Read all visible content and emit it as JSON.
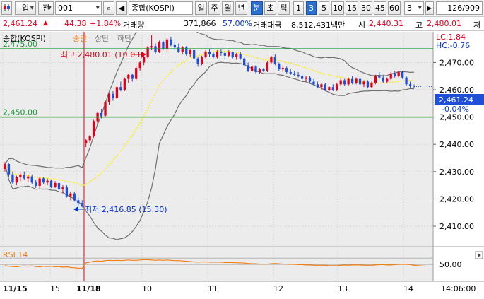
{
  "toolbar": {
    "code": "001",
    "name": "종합(KOSPI)",
    "up_label": "업",
    "all_label": "전",
    "periods": [
      "일",
      "주",
      "월",
      "년",
      "분",
      "초",
      "틱"
    ],
    "selected_period": "분",
    "intervals": [
      "1",
      "3",
      "5",
      "10",
      "15",
      "30",
      "45",
      "60"
    ],
    "selected_interval": "3",
    "interval_value": "3",
    "count": "126/909"
  },
  "quote": {
    "price": "2,461.24",
    "change": "44.38",
    "change_pct": "+1.84%",
    "volume_label": "거래량",
    "volume": "371,866",
    "volume_ratio": "57.00%",
    "amount_label": "거래대금",
    "amount": "8,512,431백만",
    "open_label": "시",
    "open": "2,440.31",
    "high_label": "고",
    "high": "2,480.01",
    "low_label": "저"
  },
  "colors": {
    "up": "#e0001a",
    "down": "#1f4ed8",
    "band": "#707070",
    "mid": "#ffee00",
    "hline": "#1a9a3a",
    "rsi": "#f07f17",
    "marker": "#e0001a"
  },
  "chart_data": [
    {
      "type": "candlestick",
      "title": "종합(KOSPI)",
      "legend": [
        "중단",
        "상단",
        "하단"
      ],
      "lc_label": "LC:1.84",
      "hc_label": "HC:-0.76",
      "ylim": [
        2403,
        2481
      ],
      "y_ticks": [
        "2,470.00",
        "2,460.00",
        "2,450.00",
        "2,440.00",
        "2,430.00",
        "2,420.00",
        "2,410.00"
      ],
      "x_labels": [
        "11/15",
        "15",
        "11/18",
        "10",
        "11",
        "12",
        "13",
        "14"
      ],
      "hlines": [
        "2,475.00",
        "2,450.00"
      ],
      "high_annotation": "최고 2,480.01 (10:03)",
      "low_annotation": "최저 2,416.85 (15:30)",
      "last_price": "2,461.24",
      "last_change": "-0.04%",
      "time": "14:06:00",
      "candles": [
        [
          2431.0,
          2433.5,
          2430.0,
          2432.8
        ],
        [
          2432.8,
          2433.0,
          2428.0,
          2429.0
        ],
        [
          2429.0,
          2430.0,
          2425.5,
          2426.0
        ],
        [
          2426.0,
          2428.5,
          2425.0,
          2427.9
        ],
        [
          2427.9,
          2429.5,
          2426.5,
          2428.8
        ],
        [
          2428.8,
          2430.0,
          2427.0,
          2427.5
        ],
        [
          2427.5,
          2429.0,
          2426.0,
          2428.2
        ],
        [
          2428.2,
          2429.0,
          2425.5,
          2426.0
        ],
        [
          2426.0,
          2427.0,
          2424.0,
          2424.8
        ],
        [
          2424.8,
          2428.0,
          2424.0,
          2427.5
        ],
        [
          2427.5,
          2428.0,
          2425.5,
          2426.0
        ],
        [
          2426.0,
          2427.5,
          2425.0,
          2426.7
        ],
        [
          2426.7,
          2427.0,
          2424.0,
          2424.5
        ],
        [
          2424.5,
          2426.5,
          2424.0,
          2425.8
        ],
        [
          2425.8,
          2426.0,
          2423.0,
          2423.5
        ],
        [
          2423.5,
          2425.0,
          2422.0,
          2424.2
        ],
        [
          2424.2,
          2425.0,
          2420.5,
          2421.0
        ],
        [
          2421.0,
          2422.5,
          2419.5,
          2422.0
        ],
        [
          2422.0,
          2422.5,
          2419.0,
          2419.5
        ],
        [
          2419.5,
          2420.5,
          2417.5,
          2418.5
        ],
        [
          2418.5,
          2419.5,
          2416.9,
          2417.2
        ],
        [
          2440.3,
          2442.0,
          2439.0,
          2441.5
        ],
        [
          2441.5,
          2443.5,
          2440.5,
          2443.0
        ],
        [
          2443.0,
          2449.0,
          2442.5,
          2448.5
        ],
        [
          2448.5,
          2452.0,
          2447.5,
          2451.5
        ],
        [
          2451.5,
          2453.0,
          2449.5,
          2450.5
        ],
        [
          2450.5,
          2456.0,
          2450.0,
          2455.5
        ],
        [
          2455.5,
          2459.0,
          2454.5,
          2458.5
        ],
        [
          2458.5,
          2459.5,
          2456.0,
          2457.0
        ],
        [
          2457.0,
          2461.5,
          2456.5,
          2461.0
        ],
        [
          2461.0,
          2463.0,
          2459.5,
          2460.0
        ],
        [
          2460.0,
          2464.5,
          2459.5,
          2464.0
        ],
        [
          2464.0,
          2466.0,
          2462.5,
          2465.5
        ],
        [
          2465.5,
          2466.0,
          2463.0,
          2464.0
        ],
        [
          2464.0,
          2468.5,
          2463.5,
          2468.0
        ],
        [
          2468.0,
          2470.5,
          2467.0,
          2470.0
        ],
        [
          2470.0,
          2472.5,
          2469.0,
          2472.0
        ],
        [
          2472.0,
          2476.0,
          2471.5,
          2475.5
        ],
        [
          2475.5,
          2480.0,
          2474.5,
          2476.0
        ],
        [
          2476.0,
          2477.0,
          2473.0,
          2474.0
        ],
        [
          2474.0,
          2478.0,
          2473.5,
          2477.5
        ],
        [
          2477.5,
          2478.0,
          2474.5,
          2475.0
        ],
        [
          2475.0,
          2479.0,
          2474.0,
          2478.5
        ],
        [
          2478.5,
          2479.5,
          2476.0,
          2476.5
        ],
        [
          2476.5,
          2477.5,
          2474.5,
          2475.5
        ],
        [
          2475.5,
          2477.0,
          2473.5,
          2474.0
        ],
        [
          2474.0,
          2476.0,
          2473.0,
          2475.5
        ],
        [
          2475.5,
          2476.0,
          2472.5,
          2473.0
        ],
        [
          2473.0,
          2475.0,
          2472.0,
          2474.5
        ],
        [
          2474.5,
          2475.0,
          2471.0,
          2471.5
        ],
        [
          2471.5,
          2472.0,
          2468.5,
          2469.5
        ],
        [
          2469.5,
          2472.5,
          2469.0,
          2472.0
        ],
        [
          2472.0,
          2474.5,
          2471.5,
          2474.0
        ],
        [
          2474.0,
          2475.0,
          2472.0,
          2473.0
        ],
        [
          2473.0,
          2474.0,
          2471.5,
          2472.0
        ],
        [
          2472.0,
          2474.5,
          2471.5,
          2474.0
        ],
        [
          2474.0,
          2475.0,
          2472.5,
          2473.5
        ],
        [
          2473.5,
          2474.0,
          2471.0,
          2472.5
        ],
        [
          2472.5,
          2474.5,
          2472.0,
          2473.8
        ],
        [
          2473.8,
          2474.0,
          2471.5,
          2472.0
        ],
        [
          2472.0,
          2473.5,
          2471.0,
          2473.0
        ],
        [
          2473.0,
          2474.0,
          2471.0,
          2471.5
        ],
        [
          2471.5,
          2472.0,
          2468.5,
          2469.0
        ],
        [
          2469.0,
          2470.0,
          2466.5,
          2467.0
        ],
        [
          2467.0,
          2469.0,
          2466.5,
          2468.5
        ],
        [
          2468.5,
          2469.0,
          2466.0,
          2466.5
        ],
        [
          2466.5,
          2468.0,
          2466.0,
          2467.5
        ],
        [
          2467.5,
          2468.0,
          2466.5,
          2467.0
        ],
        [
          2467.0,
          2470.5,
          2466.5,
          2470.0
        ],
        [
          2470.0,
          2472.5,
          2469.5,
          2472.0
        ],
        [
          2472.0,
          2473.0,
          2469.0,
          2469.5
        ],
        [
          2469.5,
          2470.0,
          2467.0,
          2467.5
        ],
        [
          2467.5,
          2469.0,
          2466.5,
          2468.0
        ],
        [
          2468.0,
          2468.5,
          2466.0,
          2466.5
        ],
        [
          2466.5,
          2467.5,
          2465.5,
          2466.0
        ],
        [
          2466.0,
          2467.0,
          2465.0,
          2465.5
        ],
        [
          2465.5,
          2466.5,
          2464.5,
          2465.0
        ],
        [
          2465.0,
          2466.0,
          2463.5,
          2464.0
        ],
        [
          2464.0,
          2465.0,
          2463.0,
          2464.5
        ],
        [
          2464.5,
          2465.0,
          2462.5,
          2463.0
        ],
        [
          2463.0,
          2464.0,
          2461.5,
          2462.0
        ],
        [
          2462.0,
          2463.0,
          2460.5,
          2461.0
        ],
        [
          2461.0,
          2462.5,
          2460.0,
          2462.0
        ],
        [
          2462.0,
          2462.5,
          2459.5,
          2460.0
        ],
        [
          2460.0,
          2461.5,
          2459.5,
          2461.0
        ],
        [
          2461.0,
          2462.0,
          2459.5,
          2460.0
        ],
        [
          2460.0,
          2462.5,
          2459.5,
          2462.0
        ],
        [
          2462.0,
          2464.0,
          2461.5,
          2463.5
        ],
        [
          2463.5,
          2464.0,
          2461.5,
          2462.0
        ],
        [
          2462.0,
          2464.5,
          2461.5,
          2464.0
        ],
        [
          2464.0,
          2465.0,
          2462.0,
          2462.5
        ],
        [
          2462.5,
          2464.5,
          2462.0,
          2464.0
        ],
        [
          2464.0,
          2464.5,
          2461.5,
          2462.0
        ],
        [
          2462.0,
          2463.5,
          2461.0,
          2463.0
        ],
        [
          2463.0,
          2463.5,
          2460.5,
          2461.0
        ],
        [
          2461.0,
          2463.0,
          2460.5,
          2462.5
        ],
        [
          2462.5,
          2465.5,
          2462.0,
          2465.0
        ],
        [
          2465.0,
          2466.5,
          2464.0,
          2464.5
        ],
        [
          2464.5,
          2465.5,
          2462.5,
          2463.0
        ],
        [
          2463.0,
          2464.5,
          2462.5,
          2464.0
        ],
        [
          2464.0,
          2466.5,
          2463.5,
          2466.0
        ],
        [
          2466.0,
          2467.0,
          2464.5,
          2465.0
        ],
        [
          2465.0,
          2467.0,
          2464.5,
          2466.5
        ],
        [
          2466.5,
          2467.0,
          2464.0,
          2464.5
        ],
        [
          2464.5,
          2465.0,
          2461.5,
          2462.0
        ],
        [
          2462.0,
          2463.0,
          2460.5,
          2461.5
        ],
        [
          2461.5,
          2462.0,
          2460.5,
          2461.2
        ]
      ]
    },
    {
      "type": "line",
      "title": "RSI 14",
      "ylim": [
        0,
        100
      ],
      "y_ticks": [
        "50.00"
      ],
      "series": [
        {
          "name": "RSI 14",
          "values": [
            46,
            44,
            43,
            42,
            44,
            45,
            44,
            45,
            43,
            42,
            44,
            43,
            44,
            42,
            43,
            41,
            42,
            40,
            39,
            38,
            37,
            55,
            57,
            60,
            61,
            60,
            62,
            63,
            62,
            63,
            62,
            63,
            64,
            63,
            63,
            64,
            65,
            65,
            64,
            63,
            64,
            63,
            64,
            63,
            62,
            62,
            61,
            60,
            59,
            58,
            57,
            58,
            58,
            57,
            57,
            57,
            57,
            56,
            56,
            56,
            55,
            55,
            54,
            53,
            52,
            52,
            51,
            51,
            51,
            52,
            53,
            52,
            51,
            51,
            50,
            50,
            49,
            49,
            48,
            48,
            47,
            47,
            47,
            47,
            46,
            46,
            46,
            47,
            48,
            47,
            48,
            48,
            48,
            47,
            47,
            47,
            48,
            49,
            49,
            48,
            48,
            49,
            50,
            50,
            50,
            49,
            47,
            46,
            45,
            44
          ]
        }
      ]
    }
  ]
}
